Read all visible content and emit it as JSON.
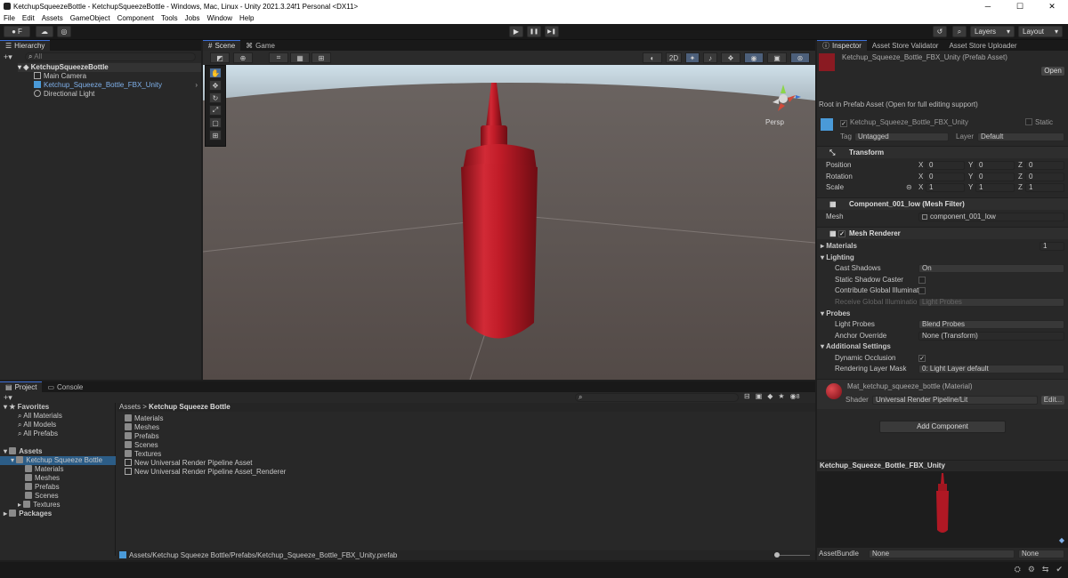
{
  "window": {
    "title": "KetchupSqueezeBottle - KetchupSqueezeBottle - Windows, Mac, Linux - Unity 2021.3.24f1 Personal <DX11>",
    "min": "─",
    "max": "☐",
    "close": "✕"
  },
  "menu": [
    "File",
    "Edit",
    "Assets",
    "GameObject",
    "Component",
    "Tools",
    "Jobs",
    "Window",
    "Help"
  ],
  "toolbar": {
    "account": "F",
    "layers": "Layers",
    "layout": "Layout",
    "play": "▶",
    "pause": "❚❚",
    "step": "▶❚"
  },
  "hierarchy": {
    "tab": "Hierarchy",
    "search_placeholder": "All",
    "scene": "KetchupSqueezeBottle",
    "items": [
      "Main Camera",
      "Ketchup_Squeeze_Bottle_FBX_Unity",
      "Directional Light"
    ]
  },
  "scene": {
    "tabs": [
      "Scene",
      "Game"
    ],
    "mode2d": "2D",
    "persp": "Persp"
  },
  "project": {
    "tabs": [
      "Project",
      "Console"
    ],
    "favorites": "Favorites",
    "fav_items": [
      "All Materials",
      "All Models",
      "All Prefabs"
    ],
    "assets": "Assets",
    "tree_root": "Ketchup Squeeze Bottle",
    "tree_children": [
      "Materials",
      "Meshes",
      "Prefabs",
      "Scenes",
      "Textures"
    ],
    "packages": "Packages",
    "breadcrumb_root": "Assets",
    "breadcrumb_sep": ">",
    "breadcrumb_current": "Ketchup Squeeze Bottle",
    "grid_items": [
      "Materials",
      "Meshes",
      "Prefabs",
      "Scenes",
      "Textures",
      "New Universal Render Pipeline Asset",
      "New Universal Render Pipeline Asset_Renderer"
    ],
    "status_path": "Assets/Ketchup Squeeze Bottle/Prefabs/Ketchup_Squeeze_Bottle_FBX_Unity.prefab",
    "count": "8"
  },
  "inspector": {
    "tabs": [
      "Inspector",
      "Asset Store Validator",
      "Asset Store Uploader"
    ],
    "asset_title": "Ketchup_Squeeze_Bottle_FBX_Unity (Prefab Asset)",
    "open": "Open",
    "root_note": "Root in Prefab Asset (Open for full editing support)",
    "object_name": "Ketchup_Squeeze_Bottle_FBX_Unity",
    "static": "Static",
    "tag_label": "Tag",
    "tag": "Untagged",
    "layer_label": "Layer",
    "layer": "Default",
    "transform": {
      "title": "Transform",
      "position": "Position",
      "rotation": "Rotation",
      "scale": "Scale",
      "pos": [
        "0",
        "0",
        "0"
      ],
      "rot": [
        "0",
        "0",
        "0"
      ],
      "scl": [
        "1",
        "1",
        "1"
      ],
      "x": "X",
      "y": "Y",
      "z": "Z"
    },
    "mesh_filter": {
      "title": "Component_001_low (Mesh Filter)",
      "mesh_label": "Mesh",
      "mesh": "component_001_low"
    },
    "mesh_renderer": {
      "title": "Mesh Renderer",
      "materials": "Materials",
      "materials_count": "1",
      "lighting": "Lighting",
      "cast_shadows": "Cast Shadows",
      "cast_shadows_val": "On",
      "static_caster": "Static Shadow Caster",
      "contribute_gi": "Contribute Global Illuminat",
      "receive_gi": "Receive Global Illuminatio",
      "receive_gi_val": "Light Probes",
      "probes": "Probes",
      "light_probes": "Light Probes",
      "light_probes_val": "Blend Probes",
      "anchor": "Anchor Override",
      "anchor_val": "None (Transform)",
      "additional": "Additional Settings",
      "dyn_occ": "Dynamic Occlusion",
      "rlm": "Rendering Layer Mask",
      "rlm_val": "0: Light Layer default"
    },
    "material": {
      "title": "Mat_ketchup_squeeze_bottle (Material)",
      "shader_label": "Shader",
      "shader": "Universal Render Pipeline/Lit",
      "edit": "Edit..."
    },
    "add_component": "Add Component",
    "preview_title": "Ketchup_Squeeze_Bottle_FBX_Unity",
    "assetbundle_label": "AssetBundle",
    "assetbundle": "None",
    "assetbundle_variant": "None"
  },
  "colors": {
    "accent": "#3d6fd8",
    "ketchup": "#b01824",
    "selected": "#2c5d87"
  }
}
